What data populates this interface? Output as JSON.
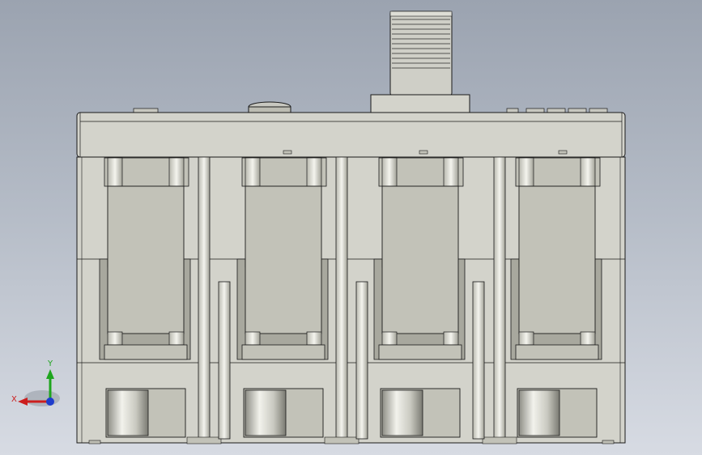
{
  "viewport": {
    "background_top": "#9ba3b0",
    "background_bottom": "#d7dbe3"
  },
  "model": {
    "body_color": "#d3d3cb",
    "face_color": "#c2c2b8",
    "shadow_color": "#a8a89e",
    "edge_color": "#1a1a1a",
    "pole_count": 4
  },
  "triad": {
    "x_label": "X",
    "y_label": "Y",
    "x_color": "#cc1e1e",
    "y_color": "#1ea51e",
    "z_color": "#1e3ccc"
  }
}
